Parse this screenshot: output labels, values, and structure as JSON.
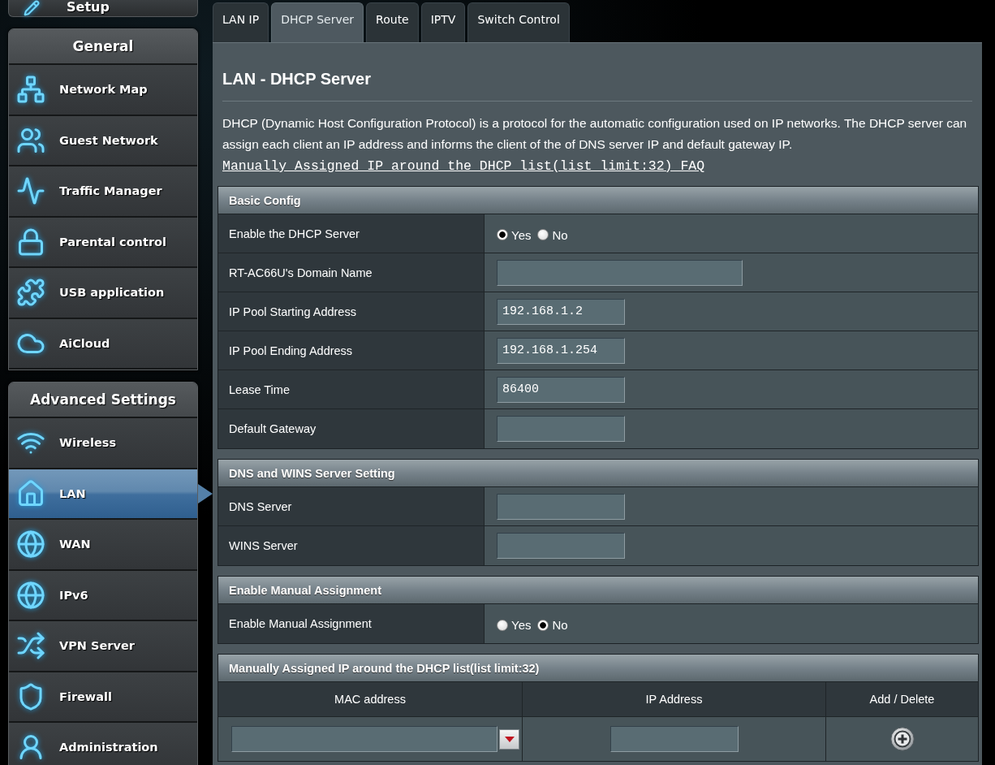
{
  "sidebar": {
    "setup": {
      "label": "Setup"
    },
    "groups": [
      {
        "title": "General",
        "items": [
          {
            "label": "Network Map",
            "selected": false
          },
          {
            "label": "Guest Network",
            "selected": false
          },
          {
            "label": "Traffic Manager",
            "selected": false
          },
          {
            "label": "Parental control",
            "selected": false
          },
          {
            "label": "USB application",
            "selected": false
          },
          {
            "label": "AiCloud",
            "selected": false
          }
        ]
      },
      {
        "title": "Advanced Settings",
        "items": [
          {
            "label": "Wireless",
            "selected": false
          },
          {
            "label": "LAN",
            "selected": true
          },
          {
            "label": "WAN",
            "selected": false
          },
          {
            "label": "IPv6",
            "selected": false
          },
          {
            "label": "VPN Server",
            "selected": false
          },
          {
            "label": "Firewall",
            "selected": false
          },
          {
            "label": "Administration",
            "selected": false
          }
        ]
      }
    ]
  },
  "tabs": [
    {
      "label": "LAN IP",
      "selected": false
    },
    {
      "label": "DHCP Server",
      "selected": true
    },
    {
      "label": "Route",
      "selected": false
    },
    {
      "label": "IPTV",
      "selected": false
    },
    {
      "label": "Switch Control",
      "selected": false
    }
  ],
  "page": {
    "title": "LAN - DHCP Server",
    "description": "DHCP (Dynamic Host Configuration Protocol) is a protocol for the automatic configuration used on IP networks. The DHCP server can assign each client an IP address and informs the client of the of DNS server IP and default gateway IP.",
    "faq_link": "Manually Assigned IP around the DHCP list(list limit:32) FAQ"
  },
  "sections": [
    {
      "title": "Basic Config",
      "rows": [
        {
          "kind": "radio",
          "label": "Enable the DHCP Server",
          "options": [
            {
              "label": "Yes",
              "selected": true
            },
            {
              "label": "No",
              "selected": false
            }
          ]
        },
        {
          "kind": "longfield",
          "label": "RT-AC66U's Domain Name"
        },
        {
          "kind": "field",
          "label": "IP Pool Starting Address",
          "value": "192.168.1.2"
        },
        {
          "kind": "field",
          "label": "IP Pool Ending Address",
          "value": "192.168.1.254"
        },
        {
          "kind": "field",
          "label": "Lease Time",
          "value": "86400"
        },
        {
          "kind": "field",
          "label": "Default Gateway"
        }
      ]
    },
    {
      "title": "DNS and WINS Server Setting",
      "rows": [
        {
          "kind": "field",
          "label": "DNS Server"
        },
        {
          "kind": "field",
          "label": "WINS Server"
        }
      ]
    },
    {
      "title": "Enable Manual Assignment",
      "rows": [
        {
          "kind": "radio",
          "label": "Enable Manual Assignment",
          "options": [
            {
              "label": "Yes",
              "selected": false
            },
            {
              "label": "No",
              "selected": true
            }
          ]
        }
      ]
    }
  ],
  "assignment_list": {
    "title": "Manually Assigned IP around the DHCP list(list limit:32)",
    "columns": [
      {
        "label": "MAC address",
        "kind": "combo"
      },
      {
        "label": "IP Address",
        "kind": "field"
      },
      {
        "label": "Add / Delete",
        "kind": "add"
      }
    ]
  }
}
